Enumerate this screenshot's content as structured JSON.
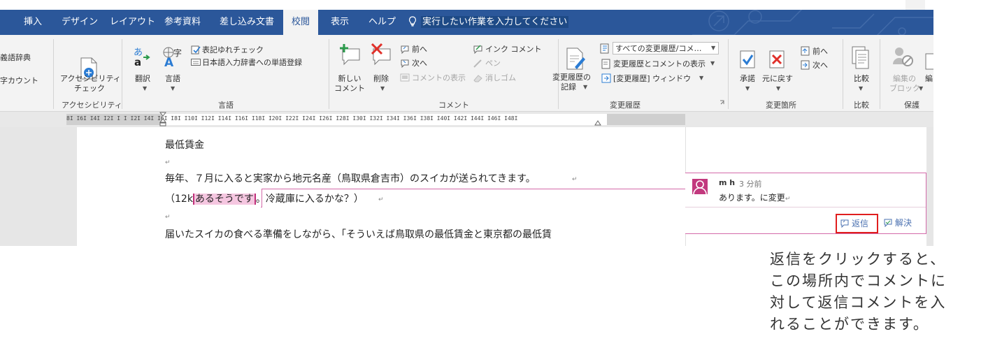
{
  "ribbon_tabs": [
    {
      "label": "挿入"
    },
    {
      "label": "デザイン"
    },
    {
      "label": "レイアウト"
    },
    {
      "label": "参考資料"
    },
    {
      "label": "差し込み文書"
    },
    {
      "label": "校閲",
      "active": true
    },
    {
      "label": "表示"
    },
    {
      "label": "ヘルプ"
    }
  ],
  "tell_me": {
    "text": "実行したい作業を入力してください",
    "icon": "lightbulb-icon"
  },
  "ribbon": {
    "proofing": {
      "thesaurus": "義語辞典",
      "word_count": "字カウント"
    },
    "accessibility": {
      "check_line1": "アクセシビリティ",
      "check_line2": "チェック",
      "group": "アクセシビリティ"
    },
    "language": {
      "translate": "翻訳",
      "language": "言語",
      "spelling_variants": "表記ゆれチェック",
      "ime_dictionary": "日本語入力辞書への単語登録",
      "group": "言語"
    },
    "comments": {
      "new_line1": "新しい",
      "new_line2": "コメント",
      "delete": "削除",
      "prev": "前へ",
      "next": "次へ",
      "show_comments": "コメントの表示",
      "ink_comment": "インク コメント",
      "pen": "ペン",
      "eraser": "消しゴム",
      "group": "コメント"
    },
    "tracking": {
      "track_line1": "変更履歴の",
      "track_line2": "記録",
      "markup_dropdown": "すべての変更履歴/コメ…",
      "show_markup": "変更履歴とコメントの表示",
      "reviewing_pane": "[変更履歴] ウィンドウ",
      "group": "変更履歴"
    },
    "changes": {
      "accept": "承諾",
      "reject": "元に戻す",
      "prev": "前へ",
      "next": "次へ",
      "group": "変更箇所"
    },
    "compare": {
      "compare": "比較",
      "group": "比較"
    },
    "protect": {
      "block_authors": "編集の",
      "block_authors2": "ブロック",
      "restrict": "編",
      "group": "保護"
    }
  },
  "ruler": {
    "ticks": "8I  I6I  I4I  I2I  I  I  I2I  I4I  I6I  I8I  I10I  I12I  I14I  I16I  I18I  I20I  I22I  I24I  I26I  I28I  I30I  I32I  I34I  I36I  I38I  I40I  I42I  I44I  I46I  I48I"
  },
  "document": {
    "line1": "最低賃金",
    "line3": "毎年、７月に入ると実家から地元名産（鳥取県倉吉市）のスイカが送られてきます。",
    "line4_pre": "（12k",
    "line4_highlight": "あるそうです",
    "line4_post": "。冷蔵庫に入るかな？）",
    "line6": "届いたスイカの食べる準備をしながら、「そういえば鳥取県の最低賃金と東京都の最低賃"
  },
  "comment": {
    "author": "m h",
    "time": "3 分前",
    "body": "あります。に変更",
    "reply_label": "返信",
    "resolve_label": "解決",
    "accent_color": "#c2397e"
  },
  "annotation": {
    "lines": [
      "返信をクリックすると、",
      "この場所内でコメントに",
      "対して返信コメントを入",
      "れることができます。"
    ],
    "highlight_color": "#e01e1e"
  }
}
